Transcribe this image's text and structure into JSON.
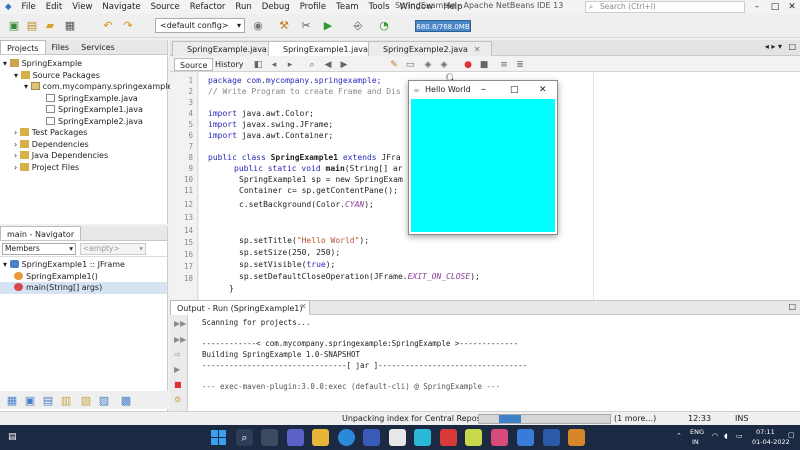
{
  "app_title": "SpringExample - Apache NetBeans IDE 13",
  "menu": [
    "File",
    "Edit",
    "View",
    "Navigate",
    "Source",
    "Refactor",
    "Run",
    "Debug",
    "Profile",
    "Team",
    "Tools",
    "Window",
    "Help"
  ],
  "search_placeholder": "Search (Ctrl+I)",
  "toolbar": {
    "config": "<default config>",
    "memory": "680.8/768.0MB"
  },
  "projects_panel": {
    "tabs": [
      "Projects",
      "Files",
      "Services"
    ],
    "tree": [
      {
        "label": "SpringExample",
        "level": 0
      },
      {
        "label": "Source Packages",
        "level": 1
      },
      {
        "label": "com.mycompany.springexample",
        "level": 2
      },
      {
        "label": "SpringExample.java",
        "level": 3
      },
      {
        "label": "SpringExample1.java",
        "level": 3
      },
      {
        "label": "SpringExample2.java",
        "level": 3
      },
      {
        "label": "Test Packages",
        "level": 1
      },
      {
        "label": "Dependencies",
        "level": 1
      },
      {
        "label": "Java Dependencies",
        "level": 1
      },
      {
        "label": "Project Files",
        "level": 1
      }
    ]
  },
  "navigator_panel": {
    "title": "main - Navigator",
    "filter1": "Members",
    "filter2": "<empty>",
    "items": [
      {
        "label": "SpringExample1 :: JFrame",
        "level": 0
      },
      {
        "label": "SpringExample1()",
        "level": 1
      },
      {
        "label": "main(String[] args)",
        "level": 1
      }
    ]
  },
  "editor": {
    "tabs": [
      "SpringExample.java",
      "SpringExample1.java",
      "SpringExample2.java"
    ],
    "active_tab": 1,
    "source_label": "Source",
    "history_label": "History",
    "line_numbers": [
      "1",
      "2",
      "3",
      "4",
      "5",
      "6",
      "7",
      "8",
      "9",
      "10",
      "11",
      "12",
      "13",
      "14",
      "15",
      "16",
      "17",
      "18"
    ],
    "code": {
      "l1a": "package com.mycompany.springexample;",
      "l2": "// Write Program to create Frame and Dis",
      "l4a": "import",
      "l4b": " java.awt.Color;",
      "l5a": "import",
      "l5b": " javax.swing.JFrame;",
      "l6a": "import",
      "l6b": " java.awt.Container;",
      "l8a": "public class",
      "l8b": " SpringExample1",
      "l8c": " extends",
      "l8d": " JFra",
      "l9a": "public static void",
      "l9b": " main",
      "l9c": "(String[] ar",
      "l10": "SpringExample1 sp = new SpringExam",
      "l11": "Container c= sp.getContentPane();",
      "l12a": "c.setBackground(Color.",
      "l12b": "CYAN",
      "l12c": ");",
      "l15a": "sp.setTitle(",
      "l15b": "\"Hello World\"",
      "l15c": ");",
      "l16": "sp.setSize(250, 250);",
      "l17a": "sp.setVisible(",
      "l17b": "true",
      "l17c": ");",
      "l18a": "sp.setDefaultCloseOperation(JFrame.",
      "l18b": "EXIT_ON_CLOSE",
      "l18c": ");",
      "l19": "}"
    }
  },
  "hello_window": {
    "title": "Hello World",
    "background": "#00FFFF"
  },
  "output": {
    "tab_label": "Output - Run (SpringExample1)",
    "lines": [
      "Scanning for projects...",
      "",
      "------------< com.mycompany.springexample:SpringExample >-------------",
      "Building SpringExample 1.0-SNAPSHOT",
      "--------------------------------[ jar ]---------------------------------",
      "",
      "--- exec-maven-plugin:3.0.0:exec (default-cli) @ SpringExample ---"
    ]
  },
  "statusbar": {
    "task": "Unpacking index for Central Repository",
    "more": "(1 more...)",
    "position": "12:33",
    "mode": "INS"
  },
  "taskbar": {
    "lang": "ENG",
    "region": "IN",
    "time": "07:11",
    "date": "01-04-2022"
  }
}
